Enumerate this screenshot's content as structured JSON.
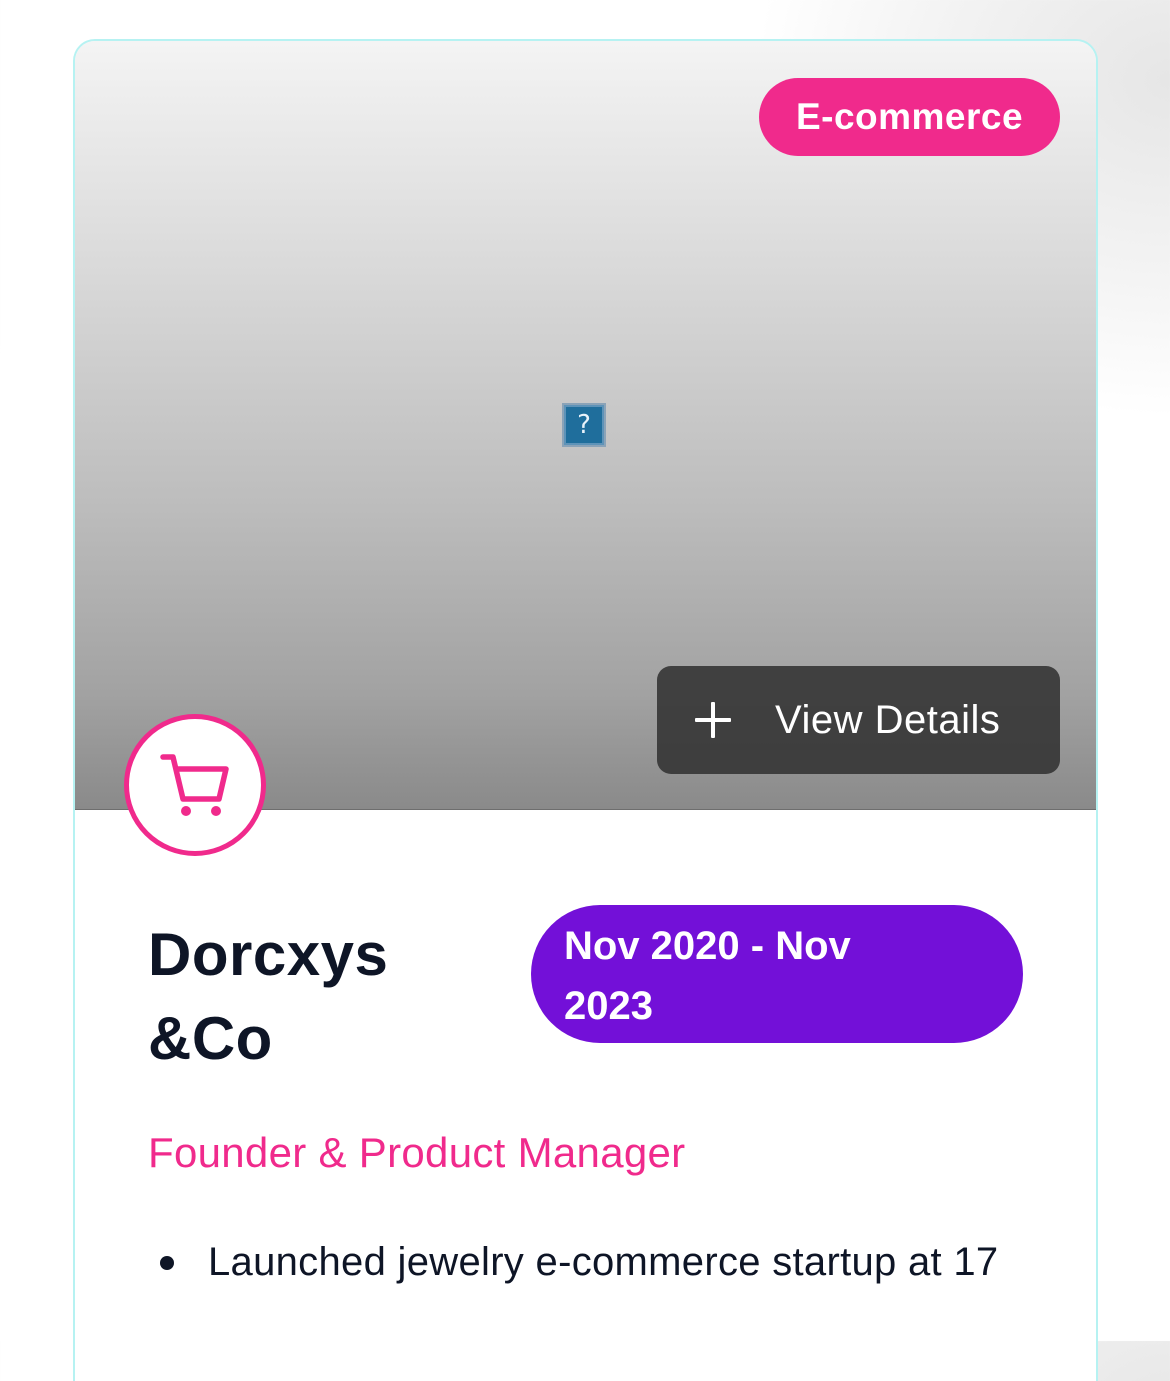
{
  "card": {
    "category": "E-commerce",
    "view_details_label": "View Details",
    "company_name": "Dorcxys &Co",
    "date_range": "Nov 2020 - Nov 2023",
    "role": "Founder & Product Manager",
    "bullets": [
      "Launched jewelry e-commerce startup at 17"
    ],
    "image_placeholder_glyph": "?",
    "icons": {
      "logo": "shopping-cart-icon",
      "view_details": "plus-icon"
    },
    "colors": {
      "accent_pink": "#f02a8c",
      "date_purple": "#7310d8",
      "card_border": "#b6f2f2",
      "text_dark": "#0e1526"
    }
  }
}
